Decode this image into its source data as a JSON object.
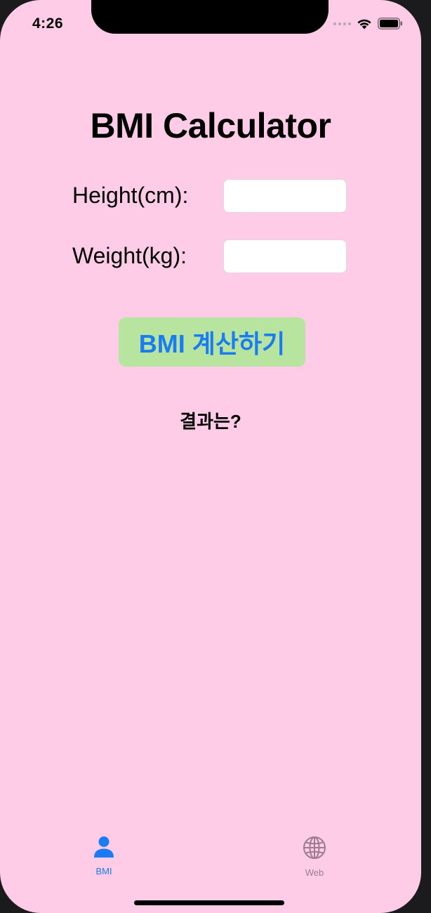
{
  "status_bar": {
    "time": "4:26"
  },
  "main": {
    "title": "BMI Calculator",
    "height_label": "Height(cm):",
    "height_value": "",
    "weight_label": "Weight(kg):",
    "weight_value": "",
    "calculate_button": "BMI 계산하기",
    "result_text": "결과는?"
  },
  "tab_bar": {
    "tabs": [
      {
        "label": "BMI",
        "icon": "person-icon",
        "selected": true
      },
      {
        "label": "Web",
        "icon": "globe-icon",
        "selected": false
      }
    ]
  },
  "colors": {
    "background": "#fecce7",
    "button_background": "#b7e5a0",
    "button_text": "#1a7cf2",
    "tab_selected": "#1a7cf2",
    "tab_unselected": "#9c7c8f"
  }
}
